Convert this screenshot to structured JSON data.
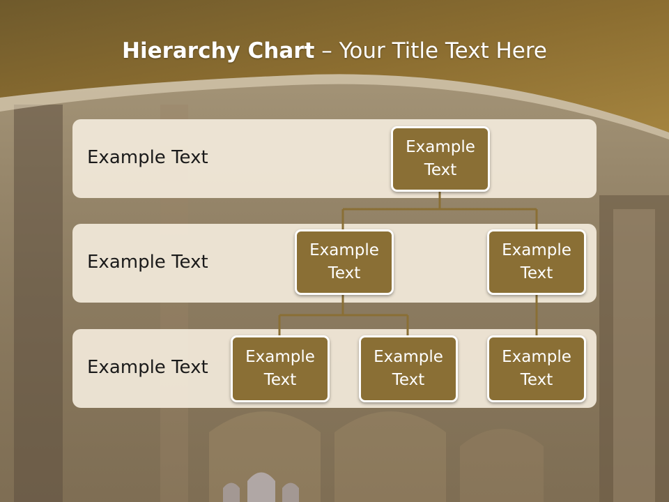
{
  "title": {
    "bold": "Hierarchy Chart",
    "rest": " – Your Title Text Here"
  },
  "rows": [
    {
      "label": "Example Text"
    },
    {
      "label": "Example Text"
    },
    {
      "label": "Example Text"
    }
  ],
  "nodes": {
    "root": {
      "line1": "Example",
      "line2": "Text"
    },
    "l2_left": {
      "line1": "Example",
      "line2": "Text"
    },
    "l2_right": {
      "line1": "Example",
      "line2": "Text"
    },
    "l3_a": {
      "line1": "Example",
      "line2": "Text"
    },
    "l3_b": {
      "line1": "Example",
      "line2": "Text"
    },
    "l3_c": {
      "line1": "Example",
      "line2": "Text"
    }
  },
  "colors": {
    "header_gold": "#8b6d30",
    "node_fill": "#8a6f35",
    "node_border": "#ffffff",
    "band_fill": "#f2eada",
    "connector": "#8a6f35"
  }
}
